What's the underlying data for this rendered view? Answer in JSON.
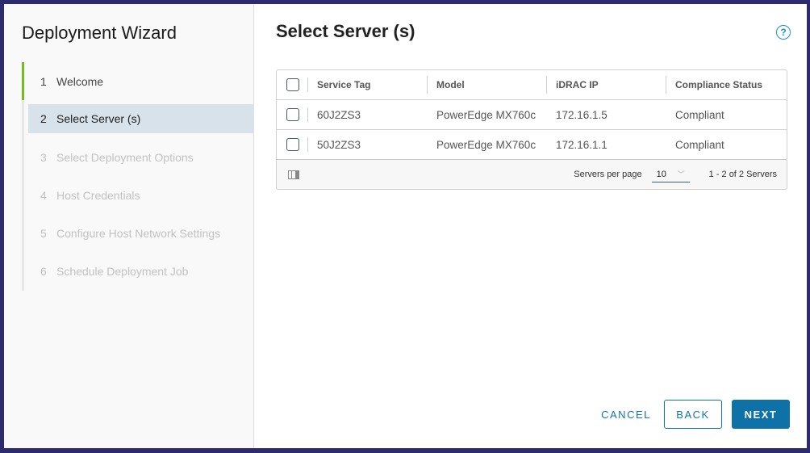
{
  "wizard": {
    "title": "Deployment Wizard",
    "steps": [
      {
        "number": "1",
        "label": "Welcome",
        "state": "done"
      },
      {
        "number": "2",
        "label": "Select Server (s)",
        "state": "active"
      },
      {
        "number": "3",
        "label": "Select Deployment Options",
        "state": "pending"
      },
      {
        "number": "4",
        "label": "Host Credentials",
        "state": "pending"
      },
      {
        "number": "5",
        "label": "Configure Host Network Settings",
        "state": "pending"
      },
      {
        "number": "6",
        "label": "Schedule Deployment Job",
        "state": "pending"
      }
    ]
  },
  "main": {
    "title": "Select Server (s)",
    "help_icon": "?"
  },
  "table": {
    "columns": [
      "Service Tag",
      "Model",
      "iDRAC IP",
      "Compliance Status"
    ],
    "rows": [
      {
        "service_tag": "60J2ZS3",
        "model": "PowerEdge MX760c",
        "idrac_ip": "172.16.1.5",
        "compliance": "Compliant"
      },
      {
        "service_tag": "50J2ZS3",
        "model": "PowerEdge MX760c",
        "idrac_ip": "172.16.1.1",
        "compliance": "Compliant"
      }
    ],
    "footer": {
      "per_page_label": "Servers per page",
      "per_page_value": "10",
      "chevron": "﹀",
      "range": "1 - 2 of 2 Servers"
    }
  },
  "buttons": {
    "cancel": "CANCEL",
    "back": "BACK",
    "next": "NEXT"
  },
  "colors": {
    "accent": "#0e72a8",
    "step_done": "#6ebe1e",
    "frame": "#2e2a6e"
  }
}
